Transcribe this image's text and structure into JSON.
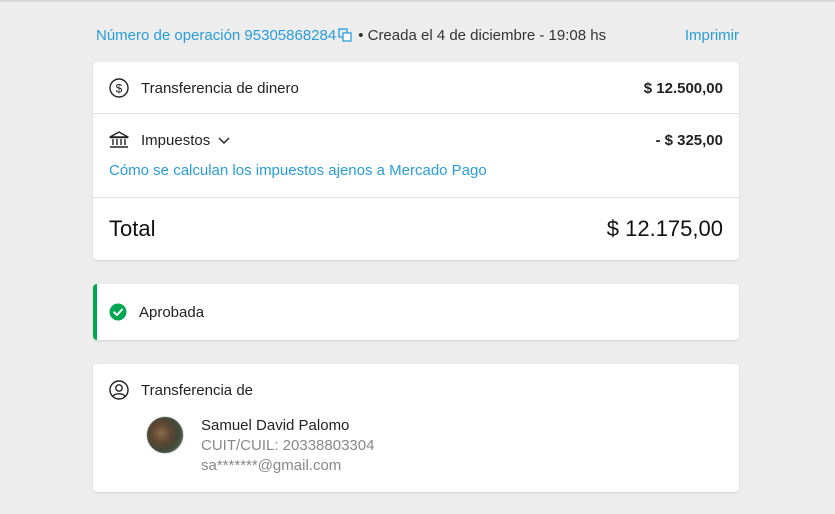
{
  "header": {
    "operation_label": "Número de operación 95305868284",
    "created": "• Creada el 4 de diciembre - 19:08 hs",
    "print": "Imprimir"
  },
  "summary": {
    "transfer_label": "Transferencia de dinero",
    "transfer_amount": "$ 12.500,00",
    "taxes_label": "Impuestos",
    "taxes_amount": "- $ 325,00",
    "taxes_link": "Cómo se calculan los impuestos ajenos a Mercado Pago",
    "total_label": "Total",
    "total_amount": "$ 12.175,00"
  },
  "status": {
    "label": "Aprobada",
    "color": "#00a650"
  },
  "sender": {
    "section_label": "Transferencia de",
    "name": "Samuel David Palomo",
    "cuit": "CUIT/CUIL: 20338803304",
    "email": "sa*******@gmail.com"
  },
  "colors": {
    "link": "#2a9dd8",
    "background": "#ededed"
  },
  "icons": {
    "copy": "copy-icon",
    "dollar": "dollar-circle-icon",
    "bank": "bank-icon",
    "chevron": "chevron-down-icon",
    "check": "check-circle-icon",
    "user": "user-circle-icon"
  }
}
